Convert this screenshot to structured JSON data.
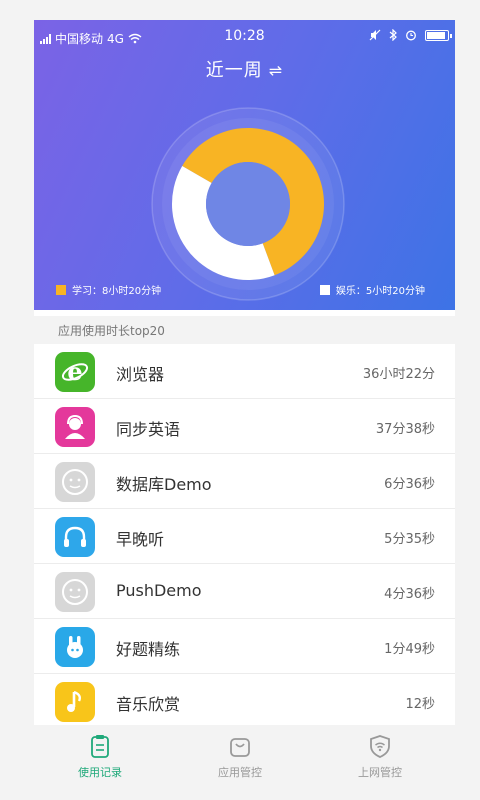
{
  "status_bar": {
    "carrier": "中国移动",
    "network": "4G",
    "time": "10:28"
  },
  "header": {
    "period_label": "近一周",
    "swap_icon": "⇌"
  },
  "usage_chart": {
    "type": "donut",
    "segments": [
      {
        "label": "学习：8小时20分钟",
        "value_minutes": 500,
        "color": "#f8b424"
      },
      {
        "label": "娱乐：5小时20分钟",
        "value_minutes": 320,
        "color": "#ffffff"
      }
    ]
  },
  "section": {
    "title": "应用使用时长top20"
  },
  "apps": [
    {
      "name": "浏览器",
      "duration": "36小时22分",
      "icon": "browser-icon",
      "bg": "#46b52a"
    },
    {
      "name": "同步英语",
      "duration": "37分38秒",
      "icon": "english-icon",
      "bg": "#e4389b"
    },
    {
      "name": "数据库Demo",
      "duration": "6分36秒",
      "icon": "default-app-icon",
      "bg": "#d7d7d7"
    },
    {
      "name": "早晚听",
      "duration": "5分35秒",
      "icon": "headphones-icon",
      "bg": "#2ea7ea"
    },
    {
      "name": "PushDemo",
      "duration": "4分36秒",
      "icon": "default-app-icon",
      "bg": "#d7d7d7"
    },
    {
      "name": "好题精练",
      "duration": "1分49秒",
      "icon": "hand-icon",
      "bg": "#29a8e8"
    },
    {
      "name": "音乐欣赏",
      "duration": "12秒",
      "icon": "music-note-icon",
      "bg": "#f8c51a"
    }
  ],
  "tabs": [
    {
      "label": "使用记录",
      "icon": "clipboard-icon",
      "active": true
    },
    {
      "label": "应用管控",
      "icon": "bag-icon",
      "active": false
    },
    {
      "label": "上网管控",
      "icon": "wifi-shield-icon",
      "active": false
    }
  ],
  "colors": {
    "accent_green": "#1fa97a",
    "study_yellow": "#f8b424"
  }
}
